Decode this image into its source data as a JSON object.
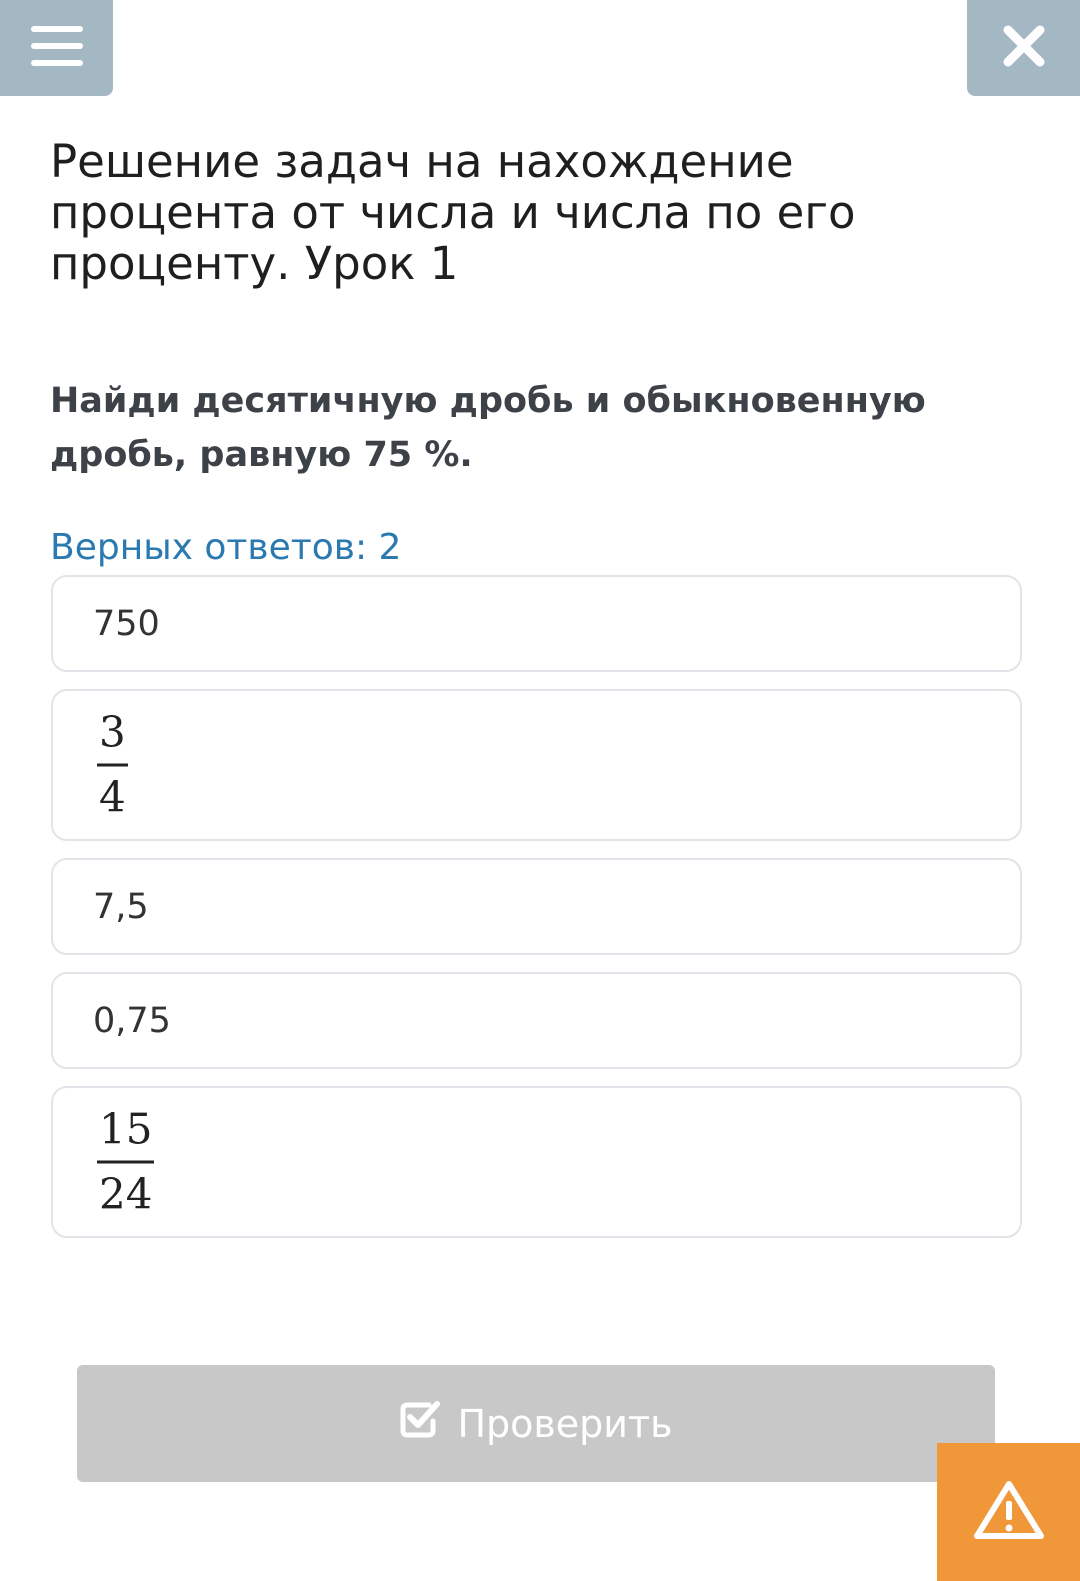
{
  "header": {
    "menu_icon": "hamburger-menu-icon",
    "close_icon": "close-icon"
  },
  "lesson": {
    "title": "Решение задач на нахождение процента от числа и числа по его проценту. Урок 1"
  },
  "question": {
    "text": "Найди десятичную дробь и обыкновенную дробь, равную 75 %.",
    "answers_count": "Верных ответов: 2"
  },
  "options": [
    {
      "text": "750"
    },
    {
      "numerator": "3",
      "denominator": "4"
    },
    {
      "text": "7,5"
    },
    {
      "text": "0,75"
    },
    {
      "numerator": "15",
      "denominator": "24"
    }
  ],
  "footer": {
    "check_label": "Проверить",
    "check_icon": "checkbox-check-icon",
    "report_icon": "warning-triangle-icon"
  },
  "colors": {
    "header_button": "#a4b8c4",
    "accent_blue": "#2a7ab0",
    "check_disabled": "#c8c8c8",
    "report_orange": "#f0973a"
  }
}
